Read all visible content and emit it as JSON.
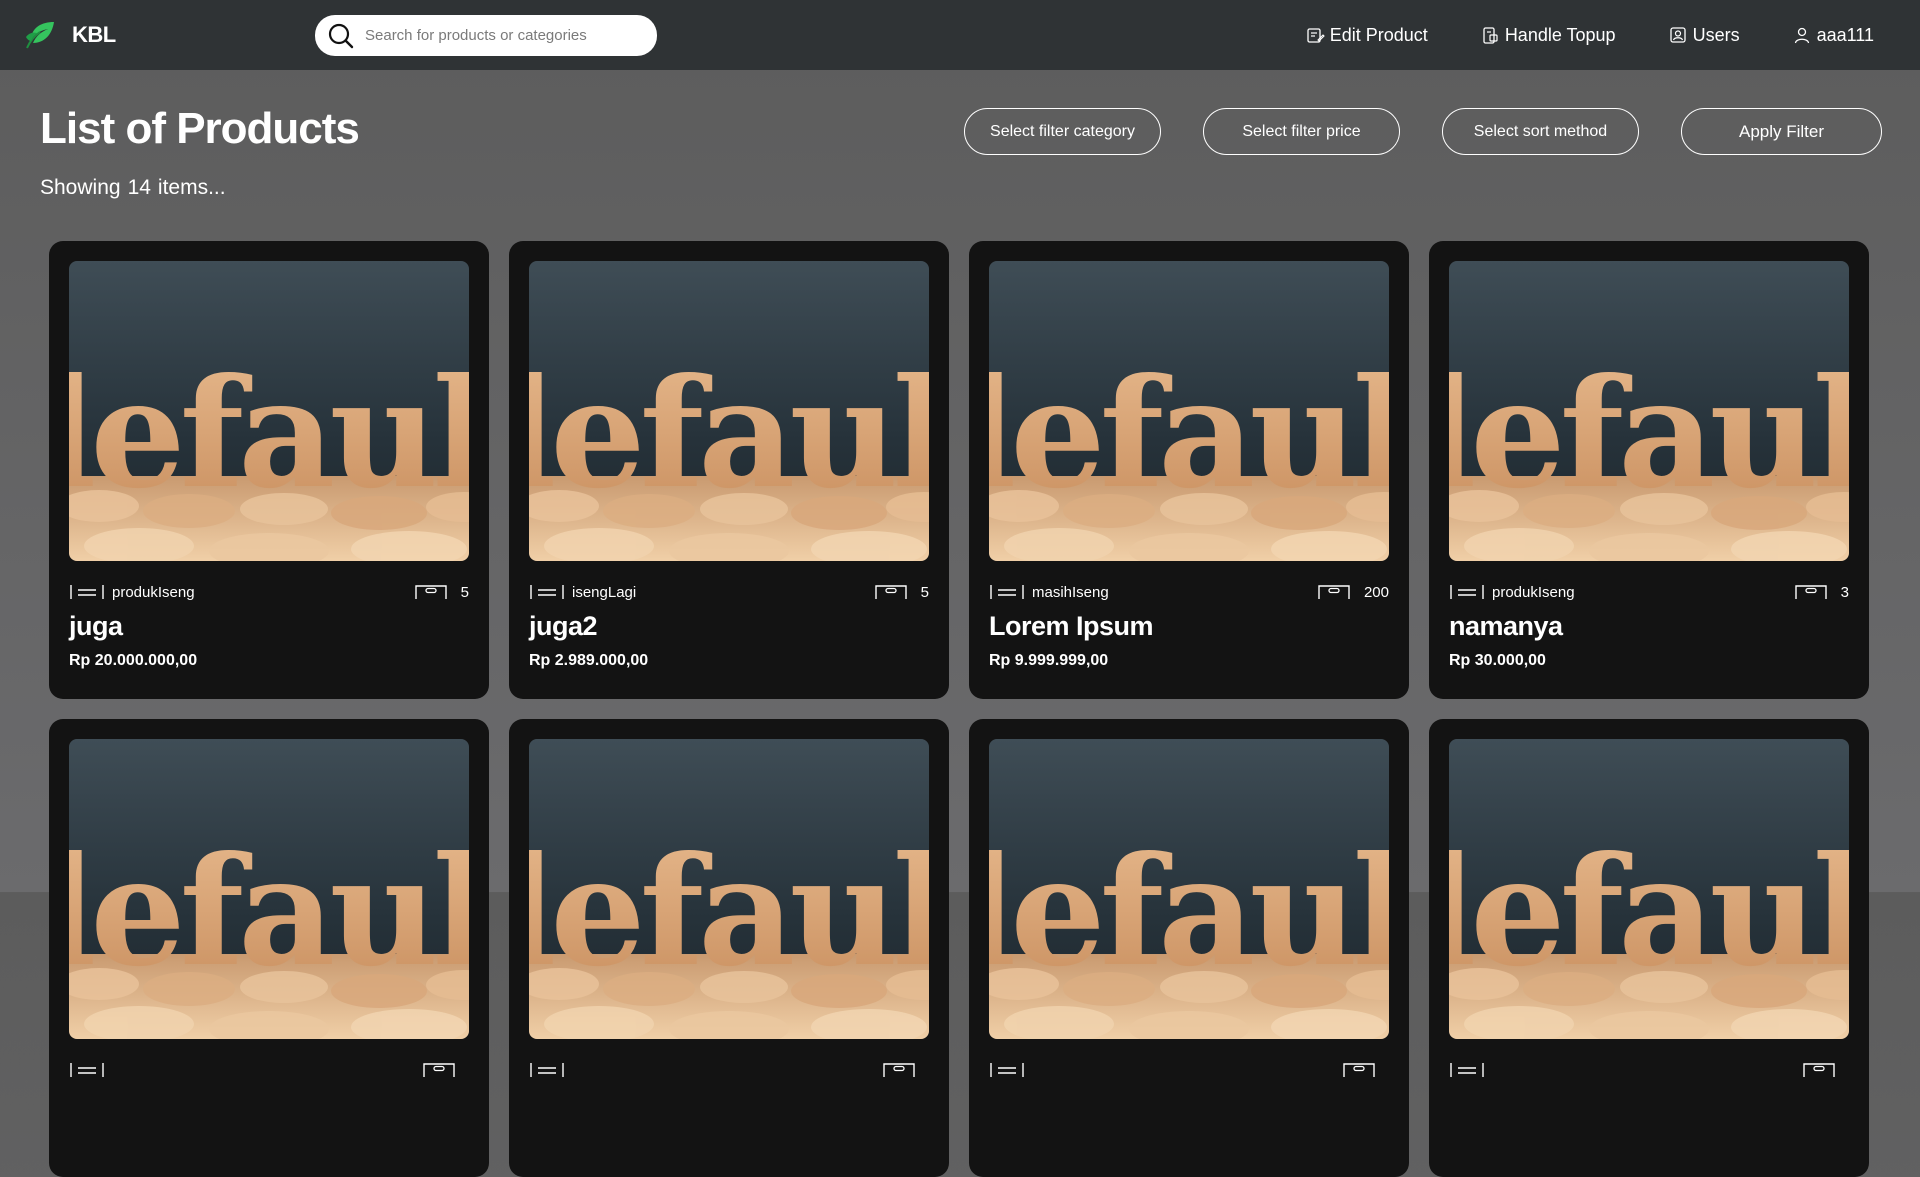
{
  "header": {
    "brand": "KBL",
    "search_placeholder": "Search for products or categories",
    "nav": [
      {
        "label": "Edit Product",
        "icon": "edit-icon"
      },
      {
        "label": "Handle Topup",
        "icon": "topup-icon"
      },
      {
        "label": "Users",
        "icon": "users-icon"
      },
      {
        "label": "aaa111",
        "icon": "user-icon"
      }
    ]
  },
  "main": {
    "title": "List of Products",
    "count_prefix": "Showing",
    "count": "14",
    "count_suffix": "items...",
    "filters": {
      "category": "Select filter category",
      "price": "Select filter price",
      "sort": "Select sort method",
      "apply": "Apply Filter"
    }
  },
  "products": [
    {
      "name": "juga",
      "category": "produkIseng",
      "stock": "5",
      "price": "Rp 20.000.000,00",
      "image_text": "default"
    },
    {
      "name": "juga2",
      "category": "isengLagi",
      "stock": "5",
      "price": "Rp 2.989.000,00",
      "image_text": "default"
    },
    {
      "name": "Lorem Ipsum",
      "category": "masihIseng",
      "stock": "200",
      "price": "Rp 9.999.999,00",
      "image_text": "default"
    },
    {
      "name": "namanya",
      "category": "produkIseng",
      "stock": "3",
      "price": "Rp 30.000,00",
      "image_text": "default"
    },
    {
      "name": "",
      "category": "",
      "stock": "",
      "price": "",
      "image_text": "default"
    },
    {
      "name": "",
      "category": "",
      "stock": "",
      "price": "",
      "image_text": "default"
    },
    {
      "name": "",
      "category": "",
      "stock": "",
      "price": "",
      "image_text": "default"
    },
    {
      "name": "",
      "category": "",
      "stock": "",
      "price": "",
      "image_text": "default"
    }
  ],
  "colors": {
    "navbar": "#2f3335",
    "card": "#131313",
    "image_bg_top": "#3a474f",
    "image_letters": "#d9a97b",
    "brand_leaf": "#2fbf5a"
  }
}
